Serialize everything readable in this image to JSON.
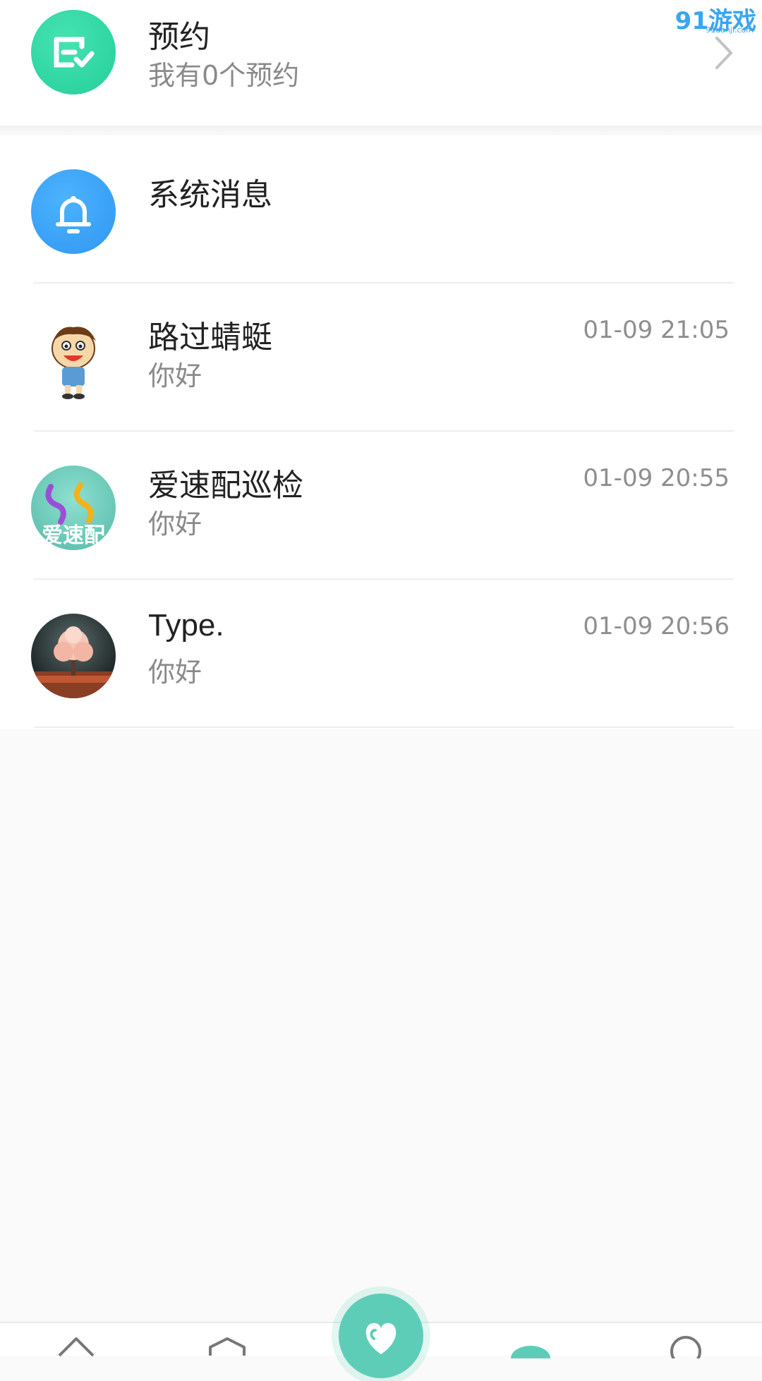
{
  "appointment": {
    "title": "预约",
    "subtitle": "我有0个预约"
  },
  "system_message": {
    "title": "系统消息"
  },
  "conversations": [
    {
      "name": "路过蜻蜓",
      "preview": "你好",
      "time": "01-09 21:05",
      "avatar": "cartoon-boy-avatar"
    },
    {
      "name": "爱速配巡检",
      "preview": "你好",
      "time": "01-09 20:55",
      "avatar": "aisupei-logo-avatar",
      "avatar_text": "爱速配"
    },
    {
      "name": "Type.",
      "preview": "你好",
      "time": "01-09 20:56",
      "avatar": "pink-tree-avatar"
    }
  ],
  "watermark": {
    "brand": "91游戏",
    "site": "91danji.com"
  },
  "colors": {
    "appointment_icon": "#2fd6a2",
    "system_icon": "#3ba2f7",
    "accent": "#5ecdb8",
    "time_text": "#8e8e8e"
  }
}
